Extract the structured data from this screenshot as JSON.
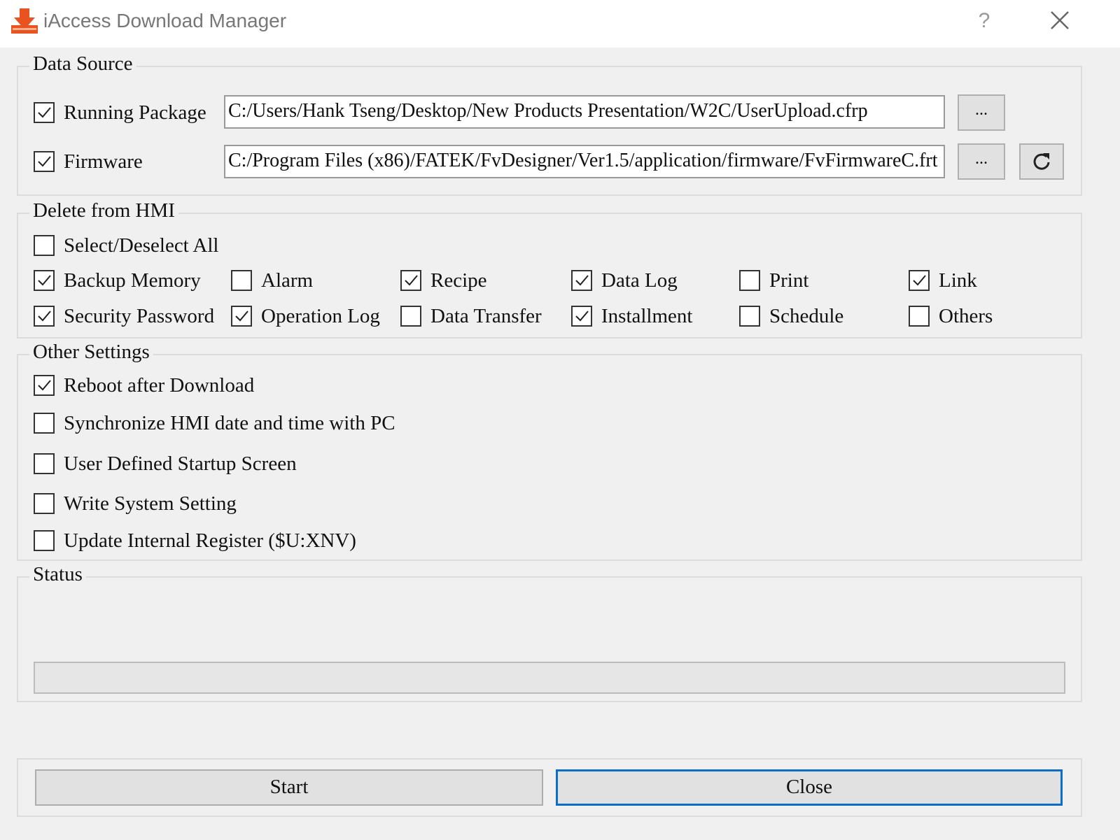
{
  "window": {
    "title": "iAccess Download Manager",
    "help_label": "?",
    "icons": {
      "app": "download-arrow-icon",
      "close": "close-icon",
      "refresh": "refresh-icon"
    },
    "colors": {
      "accent": "#0e6ec6",
      "app_icon": "#e8531f",
      "background": "#f0f0f0"
    }
  },
  "data_source": {
    "title": "Data Source",
    "running_package": {
      "label": "Running Package",
      "checked": true,
      "path": "C:/Users/Hank Tseng/Desktop/New Products Presentation/W2C/UserUpload.cfrp",
      "browse_label": "..."
    },
    "firmware": {
      "label": "Firmware",
      "checked": true,
      "path": "C:/Program Files (x86)/FATEK/FvDesigner/Ver1.5/application/firmware/FvFirmwareC.frt",
      "browse_label": "..."
    }
  },
  "delete_from_hmi": {
    "title": "Delete from HMI",
    "select_all": {
      "label": "Select/Deselect All",
      "checked": false
    },
    "items": [
      {
        "label": "Backup Memory",
        "checked": true
      },
      {
        "label": "Alarm",
        "checked": false
      },
      {
        "label": "Recipe",
        "checked": true
      },
      {
        "label": "Data Log",
        "checked": true
      },
      {
        "label": "Print",
        "checked": false
      },
      {
        "label": "Link",
        "checked": true
      },
      {
        "label": "Security Password",
        "checked": true
      },
      {
        "label": "Operation Log",
        "checked": true
      },
      {
        "label": "Data Transfer",
        "checked": false
      },
      {
        "label": "Installment",
        "checked": true
      },
      {
        "label": "Schedule",
        "checked": false
      },
      {
        "label": "Others",
        "checked": false
      }
    ]
  },
  "other_settings": {
    "title": "Other Settings",
    "items": [
      {
        "label": "Reboot after Download",
        "checked": true
      },
      {
        "label": "Synchronize HMI date and time with PC",
        "checked": false
      },
      {
        "label": "User Defined Startup Screen",
        "checked": false
      },
      {
        "label": "Write System Setting",
        "checked": false
      },
      {
        "label": "Update Internal Register ($U:XNV)",
        "checked": false
      }
    ]
  },
  "status": {
    "title": "Status",
    "progress_fraction": 0
  },
  "buttons": {
    "start_label": "Start",
    "close_label": "Close"
  }
}
